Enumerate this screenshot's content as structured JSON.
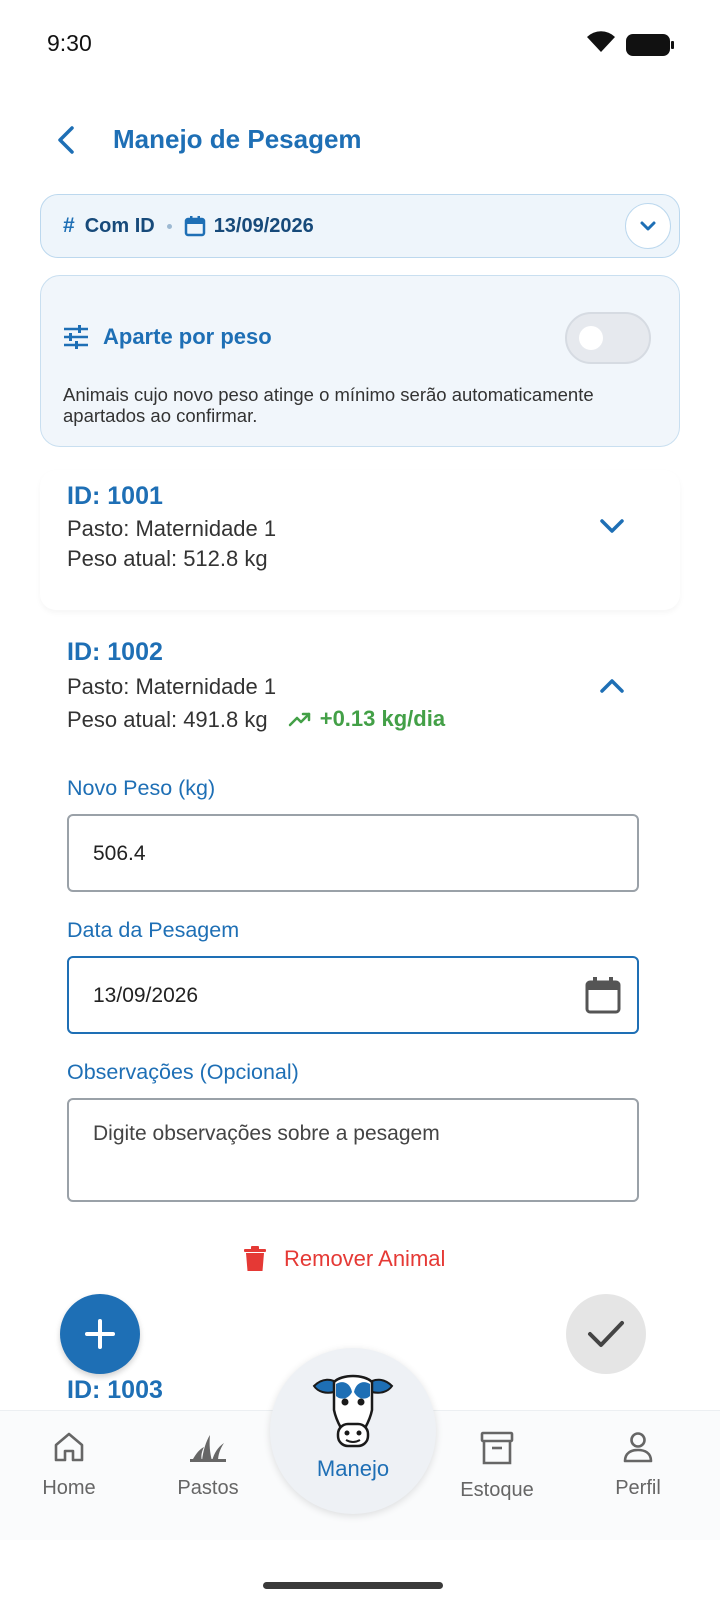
{
  "status_bar": {
    "time": "9:30"
  },
  "header": {
    "title": "Manejo de Pesagem"
  },
  "filter": {
    "mode": "Com ID",
    "date": "13/09/2026"
  },
  "aparte": {
    "title": "Aparte por peso",
    "enabled": false,
    "description": "Animais cujo novo peso atinge o mínimo serão automaticamente apartados ao confirmar."
  },
  "animals": [
    {
      "id": "ID: 1001",
      "pasto": "Pasto: Maternidade 1",
      "peso": "Peso atual: 512.8 kg",
      "expanded": false
    },
    {
      "id": "ID: 1002",
      "pasto": "Pasto: Maternidade 1",
      "peso": "Peso atual: 491.8 kg",
      "gain": "+0.13 kg/dia",
      "expanded": true,
      "form": {
        "novo_peso_label": "Novo Peso (kg)",
        "novo_peso_value": "506.4",
        "data_label": "Data da Pesagem",
        "data_value": "13/09/2026",
        "obs_label": "Observações (Opcional)",
        "obs_placeholder": "Digite observações sobre a pesagem",
        "remove_label": "Remover Animal"
      }
    },
    {
      "id": "ID: 1003"
    }
  ],
  "nav": {
    "items": [
      {
        "label": "Home",
        "icon": "home-icon"
      },
      {
        "label": "Pastos",
        "icon": "grass-icon"
      },
      {
        "label": "Manejo",
        "icon": "cow-icon",
        "active": true
      },
      {
        "label": "Estoque",
        "icon": "archive-icon"
      },
      {
        "label": "Perfil",
        "icon": "person-icon"
      }
    ]
  },
  "colors": {
    "primary": "#1e6fb5",
    "success": "#43a047",
    "danger": "#e53935"
  }
}
